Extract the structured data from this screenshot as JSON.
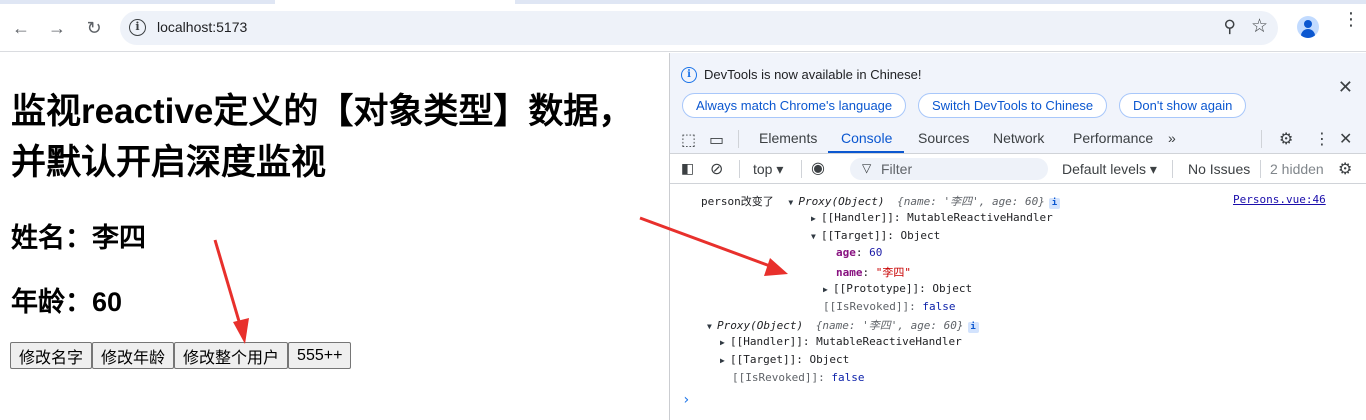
{
  "browser": {
    "url": "localhost:5173",
    "back_icon": "←",
    "forward_icon": "→",
    "reload_icon": "↻",
    "info_icon": "i",
    "zoom_icon": "⚲",
    "star_icon": "☆",
    "menu_icon": "⋮"
  },
  "page": {
    "title": "监视reactive定义的【对象类型】数据，并默认开启深度监视",
    "name_line": "姓名：李四",
    "age_line": "年龄：60",
    "buttons": [
      "修改名字",
      "修改年龄",
      "修改整个用户",
      "555++"
    ]
  },
  "devtools": {
    "banner": {
      "message": "DevTools is now available in Chinese!",
      "buttons": [
        "Always match Chrome's language",
        "Switch DevTools to Chinese",
        "Don't show again"
      ],
      "close_icon": "✕"
    },
    "tabs": [
      "Elements",
      "Console",
      "Sources",
      "Network",
      "Performance"
    ],
    "active_tab": "Console",
    "more_tabs_icon": "»",
    "toolbar": {
      "context": "top ▾",
      "filter_placeholder": "Filter",
      "levels": "Default levels ▾",
      "issues": "No Issues",
      "hidden": "2 hidden"
    },
    "console": {
      "log_label": "person改变了",
      "source_link": "Persons.vue:46",
      "proxy_label": "Proxy(Object)",
      "proxy_preview": "{name: '李四', age: 60}",
      "handler": "[[Handler]]: MutableReactiveHandler",
      "target": "[[Target]]: Object",
      "age_key": "age",
      "age_value": "60",
      "name_key": "name",
      "name_value": "\"李四\"",
      "prototype": "[[Prototype]]: Object",
      "revoked_key": "[[IsRevoked]]:",
      "revoked_value": "false",
      "prompt": "›"
    }
  }
}
